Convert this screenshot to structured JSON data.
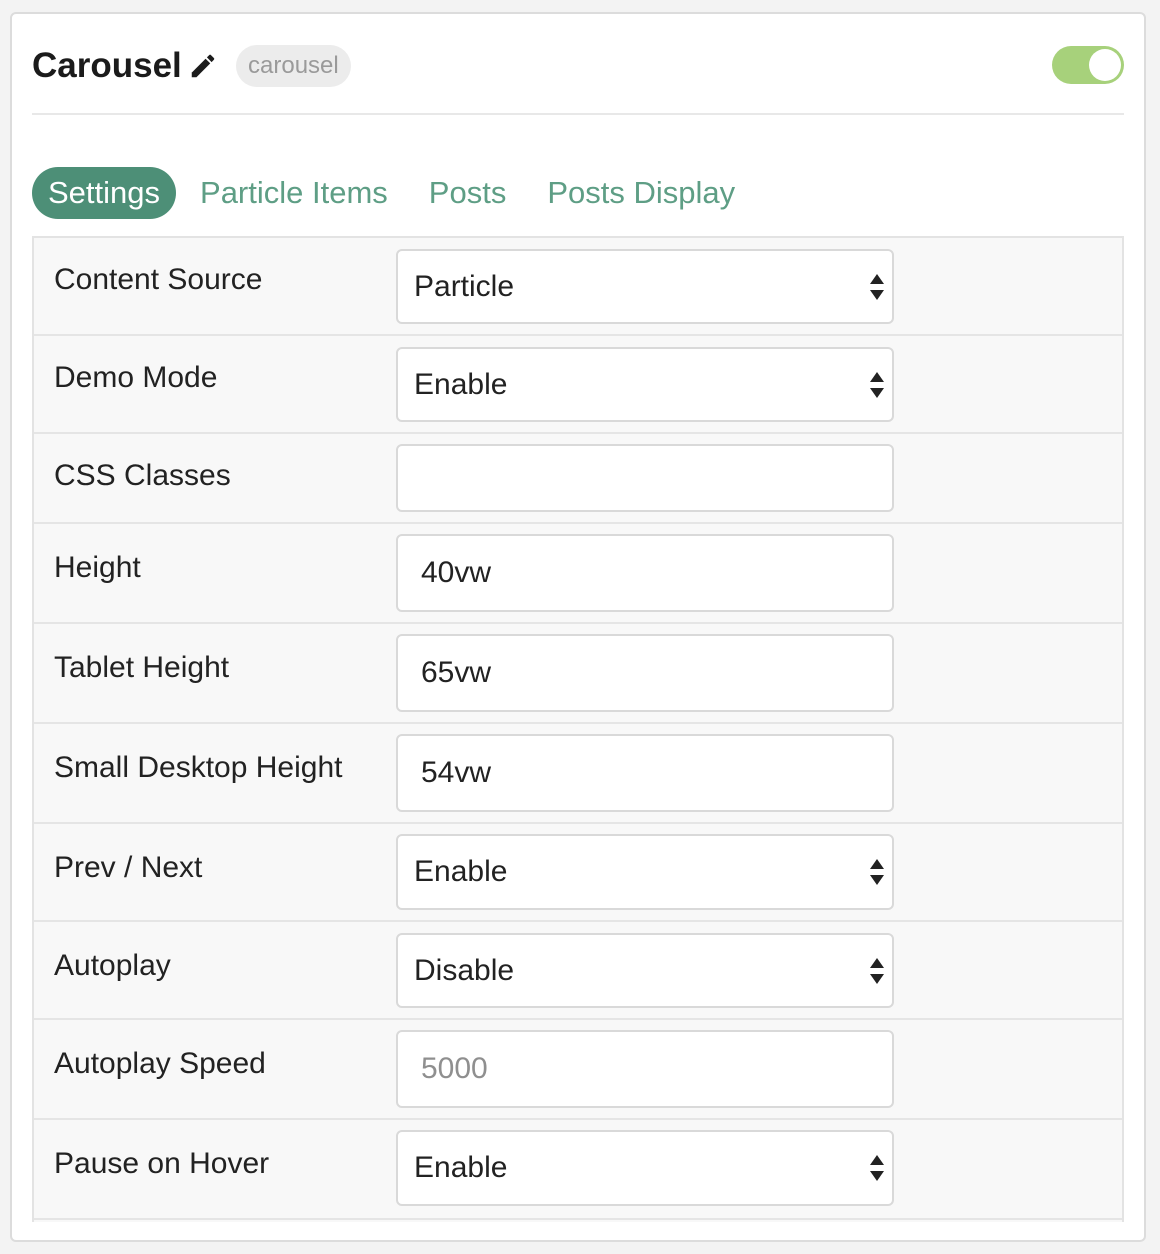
{
  "header": {
    "title": "Carousel",
    "badge": "carousel",
    "enabled": true,
    "edit_icon": "pencil-icon"
  },
  "tabs": [
    {
      "label": "Settings",
      "active": true
    },
    {
      "label": "Particle Items",
      "active": false
    },
    {
      "label": "Posts",
      "active": false
    },
    {
      "label": "Posts Display",
      "active": false
    }
  ],
  "fields": [
    {
      "label": "Content Source",
      "type": "select",
      "value": "Particle"
    },
    {
      "label": "Demo Mode",
      "type": "select",
      "value": "Enable"
    },
    {
      "label": "CSS Classes",
      "type": "text",
      "value": "",
      "placeholder": ""
    },
    {
      "label": "Height",
      "type": "text",
      "value": "40vw",
      "placeholder": ""
    },
    {
      "label": "Tablet Height",
      "type": "text",
      "value": "65vw",
      "placeholder": ""
    },
    {
      "label": "Small Desktop Height",
      "type": "text",
      "value": "54vw",
      "placeholder": ""
    },
    {
      "label": "Prev / Next",
      "type": "select",
      "value": "Enable"
    },
    {
      "label": "Autoplay",
      "type": "select",
      "value": "Disable"
    },
    {
      "label": "Autoplay Speed",
      "type": "text",
      "value": "",
      "placeholder": "5000"
    },
    {
      "label": "Pause on Hover",
      "type": "select",
      "value": "Enable"
    }
  ],
  "colors": {
    "accent": "#4d8f77",
    "tab_text": "#5e9e85",
    "toggle_on": "#a7d17b"
  }
}
